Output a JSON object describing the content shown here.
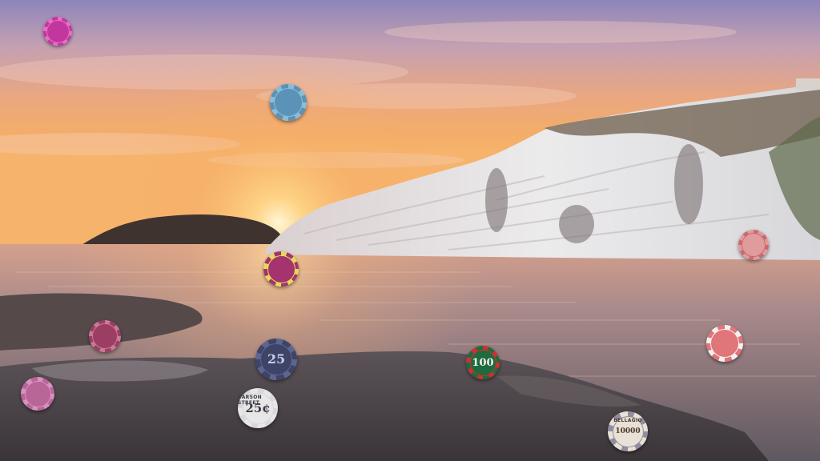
{
  "scene": {
    "description_tag": "sunset-cliff-background",
    "colors": {
      "sky_top": "#8f86b9",
      "sky_mid": "#e9ab82",
      "sky_horizon": "#f4b36a",
      "sun": "#fff2c4",
      "sea": "#8e7b82",
      "cliff": "#e7e4e2",
      "rock": "#4a4448",
      "headland": "#3c3230"
    }
  },
  "chips": [
    {
      "id": "chip-1",
      "value": "",
      "color": "#c2379e",
      "edge": "#e66fc6",
      "text_color": "#f2b6e4",
      "brand": ""
    },
    {
      "id": "chip-2",
      "value": "",
      "color": "#5a93b7",
      "edge": "#8bbbd8",
      "text_color": "#1d3e56",
      "brand": ""
    },
    {
      "id": "chip-3",
      "value": "",
      "color": "#a4336e",
      "edge": "#e8d85a",
      "text_color": "#f6c8de",
      "brand": ""
    },
    {
      "id": "chip-4",
      "value": "",
      "color": "#e09c9c",
      "edge": "#c96a73",
      "text_color": "#7a2b35",
      "brand": ""
    },
    {
      "id": "chip-5",
      "value": "",
      "color": "#9c3d64",
      "edge": "#c97a97",
      "text_color": "#f4cfe0",
      "brand": ""
    },
    {
      "id": "chip-6",
      "value": "25",
      "color": "#3e4466",
      "edge": "#5c6592",
      "text_color": "#c9cdea",
      "brand": ""
    },
    {
      "id": "chip-7",
      "value": "100",
      "color": "#1f6a3e",
      "edge": "#c9322f",
      "text_color": "#f2f2f2",
      "brand": ""
    },
    {
      "id": "chip-8",
      "value": "",
      "color": "#e0757a",
      "edge": "#f4f0f0",
      "text_color": "#7a2b35",
      "brand": ""
    },
    {
      "id": "chip-9",
      "value": "",
      "color": "#b86598",
      "edge": "#d892bf",
      "text_color": "#f6d4ea",
      "brand": ""
    },
    {
      "id": "chip-10",
      "value": "25¢",
      "color": "#e8e6e6",
      "edge": "#d8d8dc",
      "text_color": "#3a3a48",
      "brand": "CARSON STREET"
    },
    {
      "id": "chip-11",
      "value": "10000",
      "color": "#e9e0d6",
      "edge": "#8f8fa0",
      "text_color": "#4b3a2a",
      "brand": "BELLAGIO"
    }
  ]
}
